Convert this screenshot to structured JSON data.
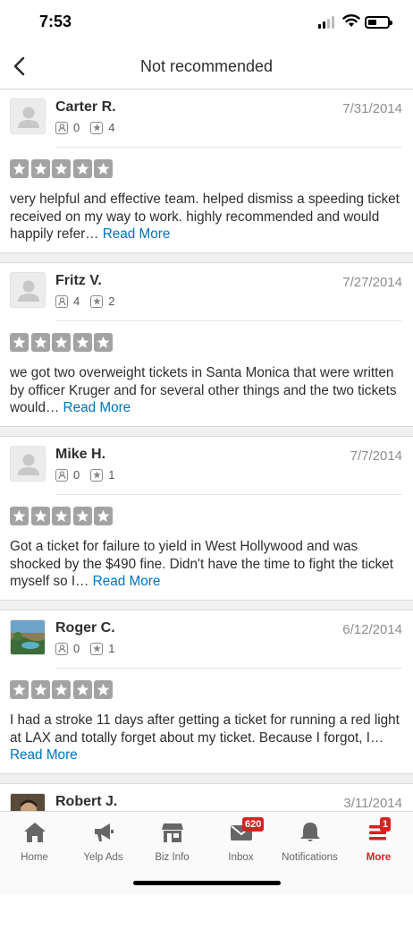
{
  "status": {
    "time": "7:53"
  },
  "header": {
    "title": "Not recommended"
  },
  "reviews": [
    {
      "name": "Carter R.",
      "date": "7/31/2014",
      "friends": "0",
      "reviews": "4",
      "text": "very helpful and effective team. helped dismiss a speeding ticket received on my way to work.  highly recommended and would happily refer…",
      "read_more": "Read More",
      "rating": 5,
      "avatar": "default"
    },
    {
      "name": "Fritz V.",
      "date": "7/27/2014",
      "friends": "4",
      "reviews": "2",
      "text": "we got two overweight tickets in Santa Monica that were written by officer Kruger and for several other things and the two tickets would…",
      "read_more": "Read More",
      "rating": 5,
      "avatar": "default"
    },
    {
      "name": "Mike H.",
      "date": "7/7/2014",
      "friends": "0",
      "reviews": "1",
      "text": "Got a ticket for failure to yield in West Hollywood and was shocked by the $490 fine. Didn't have the time to fight the ticket myself so I…",
      "read_more": "Read More",
      "rating": 5,
      "avatar": "default"
    },
    {
      "name": "Roger C.",
      "date": "6/12/2014",
      "friends": "0",
      "reviews": "1",
      "text": "I had a stroke 11 days after getting a ticket for running a red light at LAX and  totally forget about my ticket. Because I forgot, I…",
      "read_more": "Read More",
      "rating": 5,
      "avatar": "photo"
    },
    {
      "name": "Robert J.",
      "date": "3/11/2014",
      "avatar": "photo"
    }
  ],
  "tabs": [
    {
      "label": "Home",
      "icon": "home-icon"
    },
    {
      "label": "Yelp Ads",
      "icon": "megaphone-icon"
    },
    {
      "label": "Biz Info",
      "icon": "storefront-icon"
    },
    {
      "label": "Inbox",
      "icon": "inbox-icon",
      "badge": "620"
    },
    {
      "label": "Notifications",
      "icon": "bell-icon"
    },
    {
      "label": "More",
      "icon": "more-icon",
      "badge": "1",
      "active": true
    }
  ],
  "colors": {
    "accent": "#d32323",
    "link": "#0073bb",
    "star_gray": "#a3a3a3"
  }
}
